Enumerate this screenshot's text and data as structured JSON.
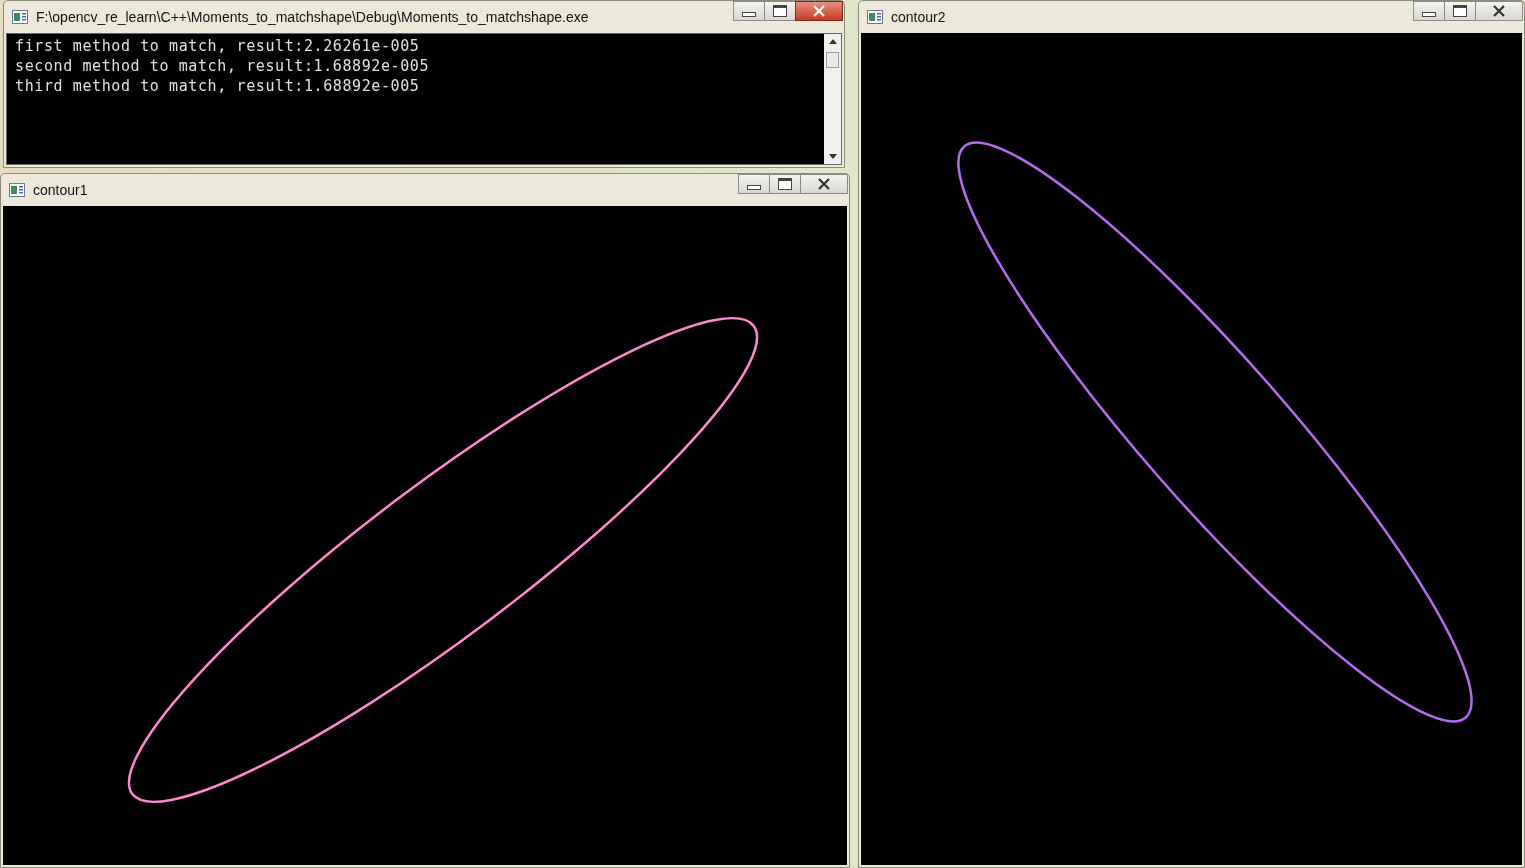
{
  "windows": [
    {
      "kind": "console",
      "title": "F:\\opencv_re_learn\\C++\\Moments_to_matchshape\\Debug\\Moments_to_matchshape.exe",
      "active": true,
      "lines": [
        "first method to match, result:2.26261e-005",
        "second method to match, result:1.68892e-005",
        "third method to match, result:1.68892e-005"
      ]
    },
    {
      "kind": "image",
      "title": "contour1",
      "active": false,
      "color": "#ff88cc"
    },
    {
      "kind": "image",
      "title": "contour2",
      "active": false,
      "color": "#b36cf0"
    }
  ]
}
